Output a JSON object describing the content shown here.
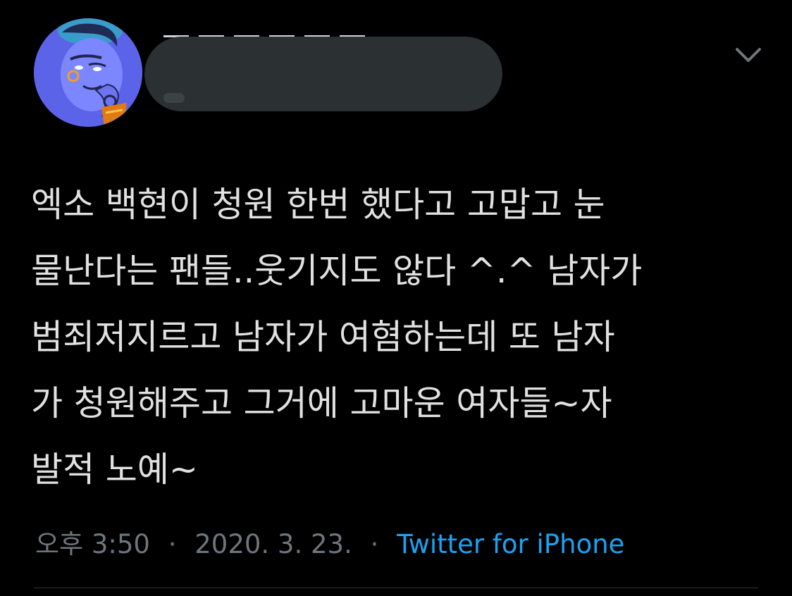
{
  "tweet": {
    "author": {
      "avatar_icon": "genie-avatar-icon",
      "name_redacted": true
    },
    "text_lines": [
      "엑소 백현이 청원 한번 했다고 고맙고 눈",
      "물난다는 팬들..웃기지도 않다 ^.^ 남자가",
      "범죄저지르고 남자가 여혐하는데 또 남자",
      "가 청원해주고 그거에 고마운 여자들~자",
      "발적 노예~"
    ],
    "meta": {
      "time": "오후 3:50",
      "separator": "·",
      "date": "2020. 3. 23.",
      "source": "Twitter for iPhone"
    }
  },
  "colors": {
    "background": "#000000",
    "text": "#e1e1e1",
    "meta_text": "#6e767d",
    "link": "#1da1f2",
    "redaction": "#2b3033",
    "divider": "#2f3336"
  },
  "icons": {
    "more": "chevron-down-icon"
  }
}
